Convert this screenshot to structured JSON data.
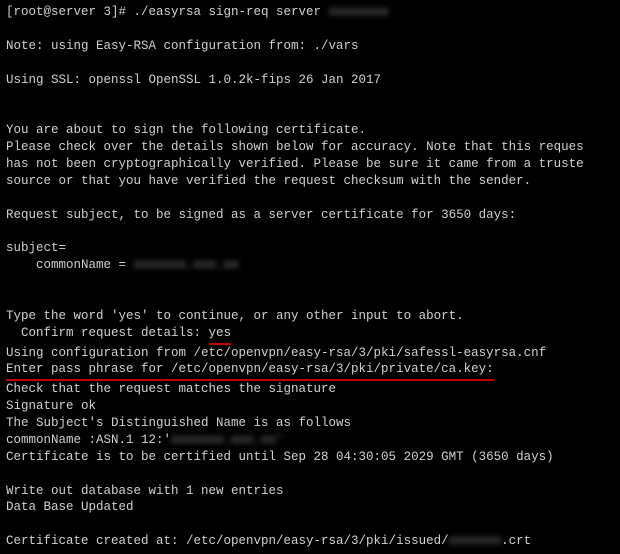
{
  "prompt": {
    "text": "[root@server 3]# ./easyrsa sign-req server ",
    "arg_blur": "xxxxxxxx"
  },
  "note_config": "Note: using Easy-RSA configuration from: ./vars",
  "ssl_line": "Using SSL: openssl OpenSSL 1.0.2k-fips  26 Jan 2017",
  "about_sign": "You are about to sign the following certificate.",
  "check_details": "Please check over the details shown below for accuracy. Note that this reques",
  "not_verified": "has not been cryptographically verified. Please be sure it came from a truste",
  "source_line": "source or that you have verified the request checksum with the sender.",
  "request_subject": "Request subject, to be signed as a server certificate for 3650 days:",
  "subject_eq": "subject=",
  "common_name_label": "commonName                = ",
  "cn_value_blur": "xxxxxxx.xxx.xx",
  "type_yes": "Type the word 'yes' to continue, or any other input to abort.",
  "confirm_label": "Confirm request details: ",
  "confirm_value": "yes",
  "using_config": "Using configuration from /etc/openvpn/easy-rsa/3/pki/safessl-easyrsa.cnf",
  "passphrase": "Enter pass phrase for /etc/openvpn/easy-rsa/3/pki/private/ca.key:",
  "check_sig": "Check that the request matches the signature",
  "sig_ok": "Signature ok",
  "dn_follows": "The Subject's Distinguished Name is as follows",
  "cn_asn": "commonName            :ASN.1 12:'",
  "cn_asn_blur": "xxxxxxx.xxx.xx'",
  "cert_until": "Certificate is to be certified until Sep 28 04:30:05 2029 GMT (3650 days)",
  "write_db": "Write out database with 1 new entries",
  "db_updated": "Data Base Updated",
  "cert_created": "Certificate created at: /etc/openvpn/easy-rsa/3/pki/issued/",
  "cert_file_blur": "xxxxxxx",
  "cert_ext": ".crt"
}
